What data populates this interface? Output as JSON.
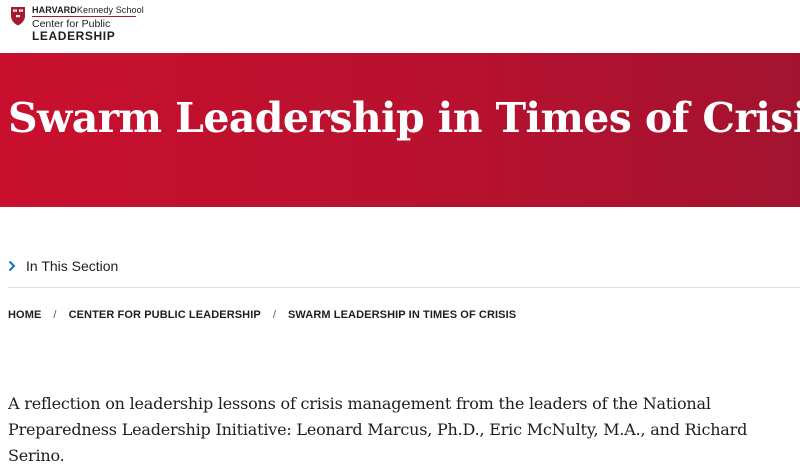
{
  "header": {
    "logo": {
      "line1_bold": "HARVARD",
      "line1_rest": "Kennedy School",
      "line2": "Center for Public",
      "line3": "LEADERSHIP"
    }
  },
  "hero": {
    "title": "Swarm Leadership in Times of Crisis",
    "background_color": "#c8102e",
    "title_color": "#ffffff"
  },
  "section_nav": {
    "label": "In This Section",
    "icon": "chevron-right-icon",
    "icon_color": "#0b7bb8"
  },
  "breadcrumb": {
    "items": [
      "HOME",
      "CENTER FOR PUBLIC LEADERSHIP",
      "SWARM LEADERSHIP IN TIMES OF CRISIS"
    ],
    "separator": "/"
  },
  "main": {
    "intro": "A reflection on leadership lessons of crisis management from the leaders of the National Preparedness Leadership Initiative: Leonard Marcus, Ph.D., Eric McNulty, M.A., and Richard Serino."
  }
}
